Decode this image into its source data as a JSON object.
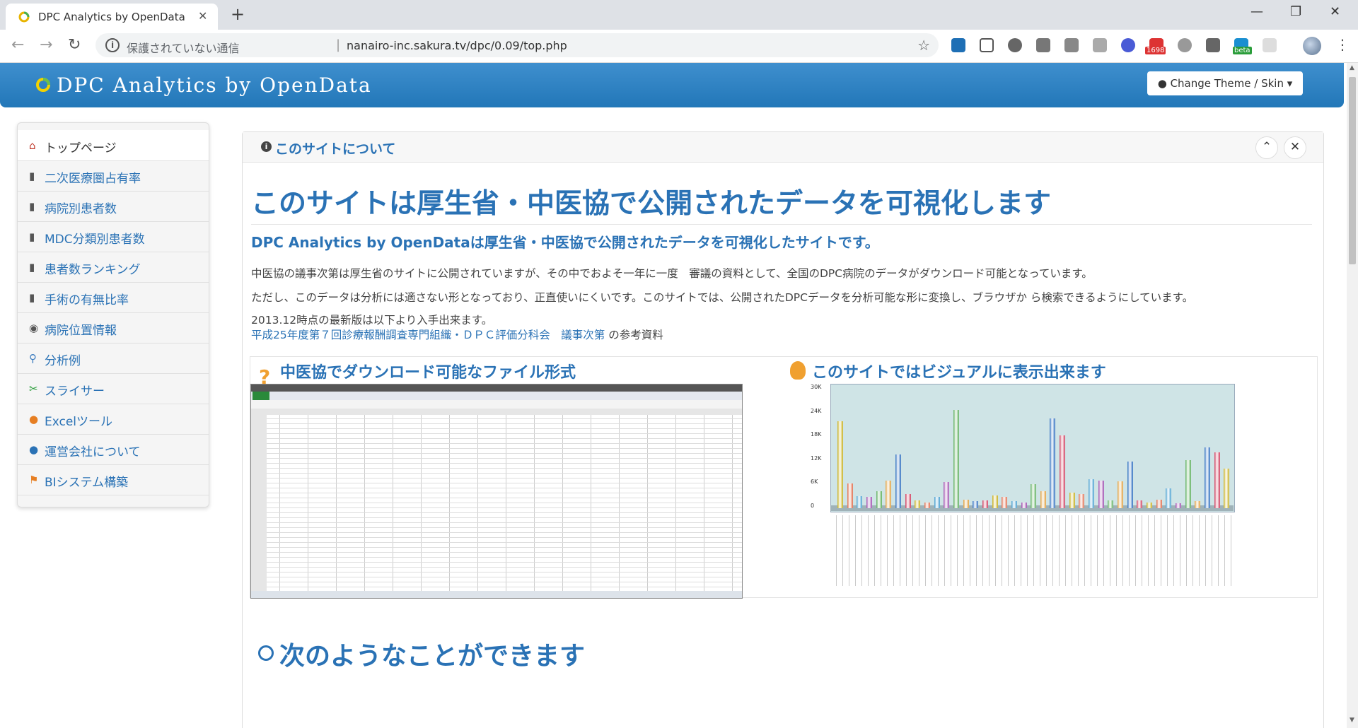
{
  "browser": {
    "tab_title": "DPC Analytics by OpenData",
    "tab_close": "✕",
    "new_tab": "+",
    "security_label": "保護されていない通信",
    "url": "nanairo-inc.sakura.tv/dpc/0.09/top.php",
    "window_buttons": {
      "minimize": "—",
      "maximize": "❐",
      "close": "✕"
    },
    "extension_badges": {
      "mail": "1698",
      "beta": "beta"
    }
  },
  "header": {
    "brand": "DPC Analytics by OpenData",
    "theme_button": "Change Theme / Skin",
    "theme_icon": "drop-icon"
  },
  "sidebar": {
    "items": [
      {
        "label": "トップページ",
        "icon": "home-icon",
        "glyph": "⌂"
      },
      {
        "label": "二次医療圏占有率",
        "icon": "bar-chart-icon",
        "glyph": "▮"
      },
      {
        "label": "病院別患者数",
        "icon": "bar-chart-icon",
        "glyph": "▮"
      },
      {
        "label": "MDC分類別患者数",
        "icon": "bar-chart-icon",
        "glyph": "▮"
      },
      {
        "label": "患者数ランキング",
        "icon": "bar-chart-icon",
        "glyph": "▮"
      },
      {
        "label": "手術の有無比率",
        "icon": "bar-chart-icon",
        "glyph": "▮"
      },
      {
        "label": "病院位置情報",
        "icon": "globe-icon",
        "glyph": "◉"
      },
      {
        "label": "分析例",
        "icon": "search-icon",
        "glyph": "⚲"
      },
      {
        "label": "スライサー",
        "icon": "scissors-icon",
        "glyph": "✂"
      },
      {
        "label": "Excelツール",
        "icon": "pumpkin-icon",
        "glyph": "●"
      },
      {
        "label": "運営会社について",
        "icon": "user-icon",
        "glyph": "●"
      },
      {
        "label": "BIシステム構築",
        "icon": "flag-icon",
        "glyph": "⚑"
      }
    ]
  },
  "panel": {
    "title": "このサイトについて",
    "collapse_icon": "⌃",
    "close_icon": "✕",
    "heading": "このサイトは厚生省・中医協で公開されたデータを可視化します",
    "lead": "DPC Analytics by OpenDataは厚生省・中医協で公開されたデータを可視化したサイトです。",
    "para1": "中医協の議事次第は厚生省のサイトに公開されていますが、その中でおよそ一年に一度　審議の資料として、全国のDPC病院のデータがダウンロード可能となっています。",
    "para2": "ただし、このデータは分析には適さない形となっており、正直使いにくいです。このサイトでは、公開されたDPCデータを分析可能な形に変換し、ブラウザか ら検索できるようにしています。",
    "para3": "2013.12時点の最新版は以下より入手出来ます。",
    "link1": "平成25年度第７回診療報酬調査専門組織・ＤＰＣ評価分科会",
    "link2": "議事次第",
    "link_suffix": "の参考資料",
    "left_box_title": "中医協でダウンロード可能なファイル形式",
    "right_box_title": "このサイトではビジュアルに表示出来ます",
    "next_heading": "次のようなことができます"
  },
  "chart_data": {
    "type": "bar",
    "y_ticks": [
      "30K",
      "24K",
      "18K",
      "12K",
      "6K",
      "0"
    ],
    "ylim": [
      0,
      30000
    ],
    "values": [
      21877,
      6212,
      3024,
      2800,
      4200,
      6944,
      13598,
      3651,
      2000,
      1500,
      2861,
      6610,
      24816,
      2182,
      1800,
      2000,
      3189,
      2772,
      1800,
      1500,
      6044,
      4300,
      22666,
      18333,
      4000,
      3600,
      7377,
      6959,
      2003,
      6859,
      11807,
      2048,
      1500,
      2092,
      4913,
      1200,
      12061,
      1800,
      15411,
      14125,
      9965
    ]
  }
}
